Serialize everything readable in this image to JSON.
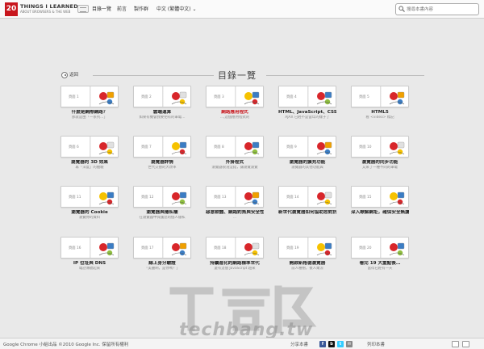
{
  "header": {
    "logo_number": "20",
    "logo_title": "THINGS I LEARNED",
    "logo_subtitle": "ABOUT BROWSERS & THE WEB",
    "nav": {
      "toc": "目錄一覽",
      "intro": "前言",
      "credits": "製作群"
    },
    "language": "中文 (繁體中文) ⌄",
    "search_placeholder": "搜尋本書內容"
  },
  "toc": {
    "back_label": "返回",
    "title": "目錄一覽",
    "page_label": "頁面",
    "items": [
      {
        "page": "1",
        "title": "什麼是網際網路？",
        "subtitle": "那就是由「一系列…」",
        "highlight": false,
        "icon": "globe-cat-icon"
      },
      {
        "page": "2",
        "title": "雲端運算",
        "subtitle": "如果有機會我要把有的筆電…",
        "highlight": false,
        "icon": "cloud-computer-icon"
      },
      {
        "page": "3",
        "title": "網路應用程式",
        "subtitle": "…,這個應用程式的",
        "highlight": true,
        "icon": "web-apps-icon"
      },
      {
        "page": "4",
        "title": "HTML、JavaScript、CSS 等",
        "subtitle": "AJAX 已經不是當年的樣子了",
        "highlight": false,
        "icon": "robot-code-icon"
      },
      {
        "page": "5",
        "title": "HTML5",
        "subtitle": "看 <video> 標記",
        "highlight": false,
        "icon": "html5-media-icon"
      },
      {
        "page": "6",
        "title": "瀏覽器的 3D 效果",
        "subtitle": "再「深度」的體驗",
        "highlight": false,
        "icon": "3d-glasses-icon"
      },
      {
        "page": "7",
        "title": "瀏覽器詳情",
        "subtitle": "世代交替的大改革",
        "highlight": false,
        "icon": "browser-history-icon"
      },
      {
        "page": "8",
        "title": "外掛程式",
        "subtitle": "瀏覽器很淺沒錯，讓瀏覽瀏覽",
        "highlight": false,
        "icon": "plugin-puzzle-icon"
      },
      {
        "page": "9",
        "title": "瀏覽器的擴充功能",
        "subtitle": "瀏覽器的其他功能與",
        "highlight": false,
        "icon": "extension-icon"
      },
      {
        "page": "10",
        "title": "瀏覽器的同步功能",
        "subtitle": "又來了一種不同的筆電",
        "highlight": false,
        "icon": "sync-icon"
      },
      {
        "page": "11",
        "title": "瀏覽器的 Cookie",
        "subtitle": "瀏覽你的資料",
        "highlight": false,
        "icon": "cookie-jar-icon"
      },
      {
        "page": "12",
        "title": "瀏覽器與隱私權",
        "subtitle": "在瀏覽器中保護您的個人隱私",
        "highlight": false,
        "icon": "privacy-icon"
      },
      {
        "page": "13",
        "title": "惡意軟體、網路釣魚與安全性風險",
        "subtitle": "…",
        "highlight": false,
        "icon": "phishing-hook-icon"
      },
      {
        "page": "14",
        "title": "新世代瀏覽器如何協助您對抗惡意軟體與網路釣魚",
        "subtitle": "",
        "highlight": false,
        "icon": "shield-robot-icon"
      },
      {
        "page": "15",
        "title": "深入瞭解網址，確保安全無虞",
        "subtitle": "",
        "highlight": false,
        "icon": "url-sign-icon"
      },
      {
        "page": "16",
        "title": "IP 位址與 DNS",
        "subtitle": "電話簿聽起來",
        "highlight": false,
        "icon": "ip-dns-icon"
      },
      {
        "page": "17",
        "title": "線上身分驗證",
        "subtitle": "「美麗啊，是你嗎？」",
        "highlight": false,
        "icon": "identity-icon"
      },
      {
        "page": "18",
        "title": "持續進化的網路標準世代",
        "subtitle": "還有這個 JavaScript 越來",
        "highlight": false,
        "icon": "evolution-icon"
      },
      {
        "page": "19",
        "title": "開啟新格德瀏覽器",
        "subtitle": "前人種樹，後人乘涼",
        "highlight": false,
        "icon": "open-browser-icon"
      },
      {
        "page": "20",
        "title": "看完 19 大重點後…",
        "subtitle": "當得已經有一天",
        "highlight": false,
        "icon": "book-finish-icon"
      }
    ]
  },
  "footer": {
    "copyright": "Google Chrome 小組出品 ©2010 Google Inc. 保留所有權利",
    "share_label": "分享本書",
    "print_label": "列印本書"
  },
  "watermark": {
    "logo": "T客邦",
    "domain": "techbang.tw"
  },
  "colors": {
    "brand_red": "#c8161d",
    "background": "#e9e9e9",
    "card_border": "#cbcbcb"
  }
}
